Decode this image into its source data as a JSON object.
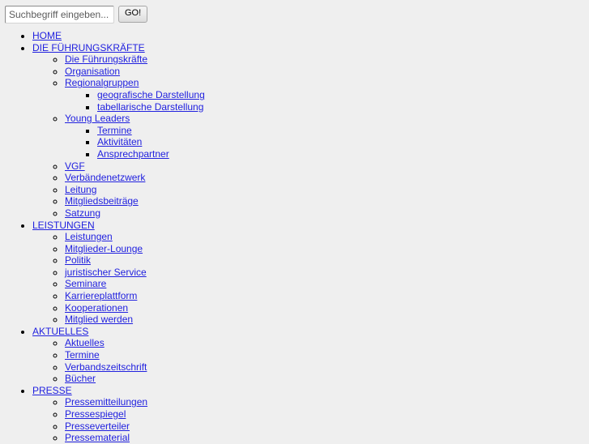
{
  "search": {
    "placeholder": "Suchbegriff eingeben...",
    "value": "",
    "submit_label": "GO!"
  },
  "colors": {
    "background": "#efefef",
    "link": "#2121df",
    "button_border": "#a6a6a6"
  },
  "nav": {
    "items": [
      {
        "label": "HOME",
        "children": []
      },
      {
        "label": "DIE FÜHRUNGSKRÄFTE",
        "children": [
          {
            "label": "Die Führungskräfte",
            "children": []
          },
          {
            "label": "Organisation",
            "children": []
          },
          {
            "label": "Regionalgruppen",
            "children": [
              {
                "label": "geografische Darstellung"
              },
              {
                "label": "tabellarische Darstellung"
              }
            ]
          },
          {
            "label": "Young Leaders",
            "children": [
              {
                "label": "Termine"
              },
              {
                "label": "Aktivitäten"
              },
              {
                "label": "Ansprechpartner"
              }
            ]
          },
          {
            "label": "VGF",
            "children": []
          },
          {
            "label": "Verbändenetzwerk",
            "children": []
          },
          {
            "label": "Leitung",
            "children": []
          },
          {
            "label": "Mitgliedsbeiträge",
            "children": []
          },
          {
            "label": "Satzung",
            "children": []
          }
        ]
      },
      {
        "label": "LEISTUNGEN",
        "children": [
          {
            "label": "Leistungen",
            "children": []
          },
          {
            "label": "Mitglieder-Lounge",
            "children": []
          },
          {
            "label": "Politik",
            "children": []
          },
          {
            "label": "juristischer Service",
            "children": []
          },
          {
            "label": "Seminare",
            "children": []
          },
          {
            "label": "Karriereplattform",
            "children": []
          },
          {
            "label": "Kooperationen",
            "children": []
          },
          {
            "label": "Mitglied werden",
            "children": []
          }
        ]
      },
      {
        "label": "AKTUELLES",
        "children": [
          {
            "label": "Aktuelles",
            "children": []
          },
          {
            "label": "Termine",
            "children": []
          },
          {
            "label": "Verbandszeitschrift",
            "children": []
          },
          {
            "label": "Bücher",
            "children": []
          }
        ]
      },
      {
        "label": "PRESSE",
        "children": [
          {
            "label": "Pressemitteilungen",
            "children": []
          },
          {
            "label": "Pressespiegel",
            "children": []
          },
          {
            "label": "Presseverteiler",
            "children": []
          },
          {
            "label": "Pressematerial",
            "children": []
          }
        ]
      }
    ]
  }
}
